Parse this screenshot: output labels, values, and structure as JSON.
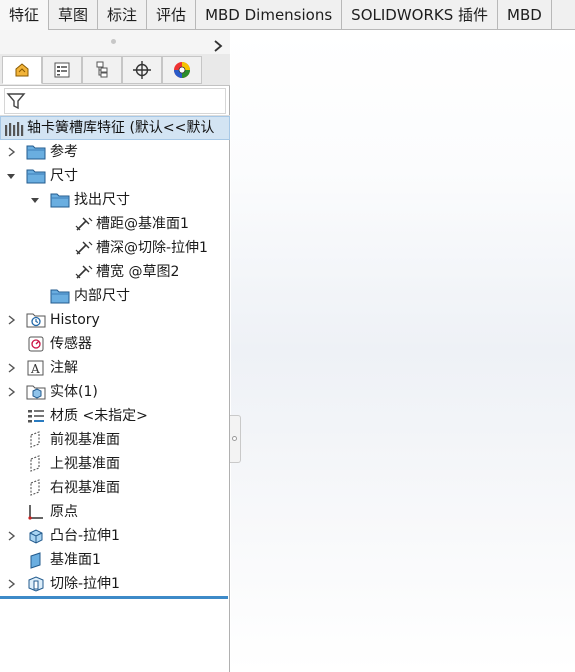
{
  "command_tabs": [
    "特征",
    "草图",
    "标注",
    "评估",
    "MBD Dimensions",
    "SOLIDWORKS 插件",
    "MBD"
  ],
  "panel_tabs": [
    {
      "icon": "feature-manager-icon"
    },
    {
      "icon": "property-manager-icon"
    },
    {
      "icon": "configuration-manager-icon"
    },
    {
      "icon": "dimxpert-manager-icon"
    },
    {
      "icon": "display-manager-icon"
    }
  ],
  "filter": {
    "icon": "filter-icon"
  },
  "tree": {
    "root_label": "轴卡簧槽库特征  (默认<<默认",
    "items": [
      {
        "label": "参考",
        "icon": "folder-icon",
        "expand": "collapsed",
        "level": 0
      },
      {
        "label": "尺寸",
        "icon": "folder-icon",
        "expand": "expanded",
        "level": 0
      },
      {
        "label": "找出尺寸",
        "icon": "folder-icon",
        "expand": "expanded",
        "level": 1
      },
      {
        "label": "槽距@基准面1",
        "icon": "dimension-icon",
        "expand": "none",
        "level": 2
      },
      {
        "label": "槽深@切除-拉伸1",
        "icon": "dimension-icon",
        "expand": "none",
        "level": 2
      },
      {
        "label": "槽宽 @草图2",
        "icon": "dimension-icon",
        "expand": "none",
        "level": 2
      },
      {
        "label": "内部尺寸",
        "icon": "folder-icon",
        "expand": "none",
        "level": 1
      },
      {
        "label": "History",
        "icon": "history-icon",
        "expand": "collapsed",
        "level": 0
      },
      {
        "label": "传感器",
        "icon": "sensor-icon",
        "expand": "none",
        "level": 0
      },
      {
        "label": "注解",
        "icon": "annotation-icon",
        "expand": "collapsed",
        "level": 0
      },
      {
        "label": "实体(1)",
        "icon": "solid-bodies-icon",
        "expand": "collapsed",
        "level": 0
      },
      {
        "label": "材质 <未指定>",
        "icon": "material-icon",
        "expand": "none",
        "level": 0
      },
      {
        "label": "前视基准面",
        "icon": "plane-icon",
        "expand": "none",
        "level": 0
      },
      {
        "label": "上视基准面",
        "icon": "plane-icon",
        "expand": "none",
        "level": 0
      },
      {
        "label": "右视基准面",
        "icon": "plane-icon",
        "expand": "none",
        "level": 0
      },
      {
        "label": "原点",
        "icon": "origin-icon",
        "expand": "none",
        "level": 0
      },
      {
        "label": "凸台-拉伸1",
        "icon": "boss-extrude-icon",
        "expand": "collapsed",
        "level": 0
      },
      {
        "label": "基准面1",
        "icon": "plane-feature-icon",
        "expand": "none",
        "level": 0
      },
      {
        "label": "切除-拉伸1",
        "icon": "cut-extrude-icon",
        "expand": "collapsed",
        "level": 0
      }
    ]
  },
  "colors": {
    "selection_bg": "#d3e4f3",
    "rollback_bar": "#3d8ac8",
    "folder_fill": "#6aaee0"
  }
}
